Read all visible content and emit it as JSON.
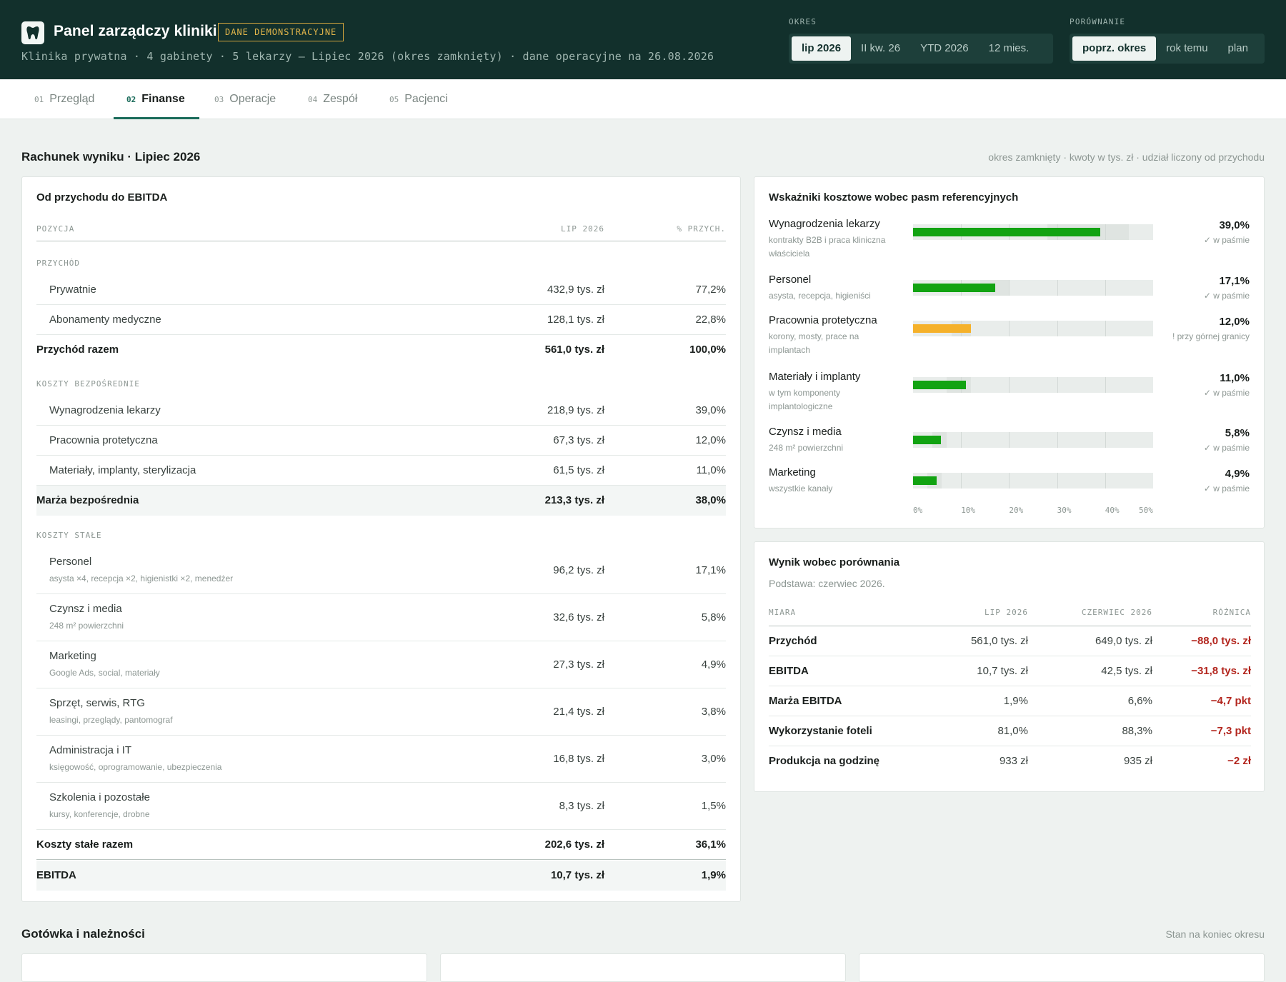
{
  "header": {
    "title": "Panel zarządczy kliniki",
    "badge": "DANE DEMONSTRACYJNE",
    "subtitle": "Klinika prywatna · 4 gabinety · 5 lekarzy — Lipiec 2026 (okres zamknięty) · dane operacyjne na 26.08.2026",
    "period_label": "OKRES",
    "period_options": [
      "lip 2026",
      "II kw. 26",
      "YTD 2026",
      "12 mies."
    ],
    "period_selected": "lip 2026",
    "compare_label": "PORÓWNANIE",
    "compare_options": [
      "poprz. okres",
      "rok temu",
      "plan"
    ],
    "compare_selected": "poprz. okres"
  },
  "tabs": [
    {
      "num": "01",
      "label": "Przegląd"
    },
    {
      "num": "02",
      "label": "Finanse"
    },
    {
      "num": "03",
      "label": "Operacje"
    },
    {
      "num": "04",
      "label": "Zespół"
    },
    {
      "num": "05",
      "label": "Pacjenci"
    }
  ],
  "active_tab": "Finanse",
  "pl_section": {
    "title": "Rachunek wyniku · Lipiec 2026",
    "note": "okres zamknięty · kwoty w tys. zł · udział liczony od przychodu"
  },
  "pl_card": {
    "title": "Od przychodu do EBITDA",
    "col_item": "POZYCJA",
    "col_value": "LIP 2026",
    "col_share": "% PRZYCH.",
    "groups": {
      "revenue": "PRZYCHÓD",
      "direct": "KOSZTY BEZPOŚREDNIE",
      "fixed": "KOSZTY STAŁE"
    },
    "rows": {
      "prywatnie": {
        "label": "Prywatnie",
        "value": "432,9 tys. zł",
        "share": "77,2%"
      },
      "abonamenty": {
        "label": "Abonamenty medyczne",
        "value": "128,1 tys. zł",
        "share": "22,8%"
      },
      "przychod_razem": {
        "label": "Przychód razem",
        "value": "561,0 tys. zł",
        "share": "100,0%"
      },
      "wyn_lekarzy": {
        "label": "Wynagrodzenia lekarzy",
        "value": "218,9 tys. zł",
        "share": "39,0%"
      },
      "pracownia": {
        "label": "Pracownia protetyczna",
        "value": "67,3 tys. zł",
        "share": "12,0%"
      },
      "materialy": {
        "label": "Materiały, implanty, sterylizacja",
        "value": "61,5 tys. zł",
        "share": "11,0%"
      },
      "marza": {
        "label": "Marża bezpośrednia",
        "value": "213,3 tys. zł",
        "share": "38,0%"
      },
      "personel": {
        "label": "Personel",
        "sub": "asysta ×4, recepcja ×2, higienistki ×2, menedżer",
        "value": "96,2 tys. zł",
        "share": "17,1%"
      },
      "czynsz": {
        "label": "Czynsz i media",
        "sub": "248 m² powierzchni",
        "value": "32,6 tys. zł",
        "share": "5,8%"
      },
      "marketing": {
        "label": "Marketing",
        "sub": "Google Ads, social, materiały",
        "value": "27,3 tys. zł",
        "share": "4,9%"
      },
      "sprzet": {
        "label": "Sprzęt, serwis, RTG",
        "sub": "leasingi, przeglądy, pantomograf",
        "value": "21,4 tys. zł",
        "share": "3,8%"
      },
      "admin": {
        "label": "Administracja i IT",
        "sub": "księgowość, oprogramowanie, ubezpieczenia",
        "value": "16,8 tys. zł",
        "share": "3,0%"
      },
      "szkolenia": {
        "label": "Szkolenia i pozostałe",
        "sub": "kursy, konferencje, drobne",
        "value": "8,3 tys. zł",
        "share": "1,5%"
      },
      "stale_razem": {
        "label": "Koszty stałe razem",
        "value": "202,6 tys. zł",
        "share": "36,1%"
      },
      "ebitda": {
        "label": "EBITDA",
        "value": "10,7 tys. zł",
        "share": "1,9%"
      }
    }
  },
  "indicators": {
    "title": "Wskaźniki kosztowe wobec pasm referencyjnych",
    "axis_ticks": [
      "0%",
      "10%",
      "20%",
      "30%",
      "40%",
      "50%"
    ],
    "axis_max": 50,
    "items": [
      {
        "name": "Wynagrodzenia lekarzy",
        "sub": "kontrakty B2B i praca kliniczna właściciela",
        "value": "39,0%",
        "pct": 39.0,
        "band": [
          28,
          45
        ],
        "status": "✓ w paśmie",
        "color": "#12a312"
      },
      {
        "name": "Personel",
        "sub": "asysta, recepcja, higieniści",
        "value": "17,1%",
        "pct": 17.1,
        "band": [
          14,
          20
        ],
        "status": "✓ w paśmie",
        "color": "#12a312"
      },
      {
        "name": "Pracownia protetyczna",
        "sub": "korony, mosty, prace na implantach",
        "value": "12,0%",
        "pct": 12.0,
        "band": [
          8,
          12
        ],
        "status": "! przy górnej granicy",
        "color": "#f5b12a"
      },
      {
        "name": "Materiały i implanty",
        "sub": "w tym komponenty implantologiczne",
        "value": "11,0%",
        "pct": 11.0,
        "band": [
          7,
          12
        ],
        "status": "✓ w paśmie",
        "color": "#12a312"
      },
      {
        "name": "Czynsz i media",
        "sub": "248 m² powierzchni",
        "value": "5,8%",
        "pct": 5.8,
        "band": [
          4,
          7
        ],
        "status": "✓ w paśmie",
        "color": "#12a312"
      },
      {
        "name": "Marketing",
        "sub": "wszystkie kanały",
        "value": "4,9%",
        "pct": 4.9,
        "band": [
          3,
          6
        ],
        "status": "✓ w paśmie",
        "color": "#12a312"
      }
    ]
  },
  "comparison": {
    "title": "Wynik wobec porównania",
    "basis": "Podstawa: czerwiec 2026.",
    "col_measure": "MIARA",
    "col_current": "LIP 2026",
    "col_prev": "CZERWIEC 2026",
    "col_diff": "RÓŻNICA",
    "rows": [
      {
        "measure": "Przychód",
        "current": "561,0 tys. zł",
        "prev": "649,0 tys. zł",
        "diff": "−88,0 tys. zł"
      },
      {
        "measure": "EBITDA",
        "current": "10,7 tys. zł",
        "prev": "42,5 tys. zł",
        "diff": "−31,8 tys. zł"
      },
      {
        "measure": "Marża EBITDA",
        "current": "1,9%",
        "prev": "6,6%",
        "diff": "−4,7 pkt"
      },
      {
        "measure": "Wykorzystanie foteli",
        "current": "81,0%",
        "prev": "88,3%",
        "diff": "−7,3 pkt"
      },
      {
        "measure": "Produkcja na godzinę",
        "current": "933 zł",
        "prev": "935 zł",
        "diff": "−2 zł"
      }
    ]
  },
  "cash_section": {
    "title": "Gotówka i należności",
    "note": "Stan na koniec okresu"
  }
}
